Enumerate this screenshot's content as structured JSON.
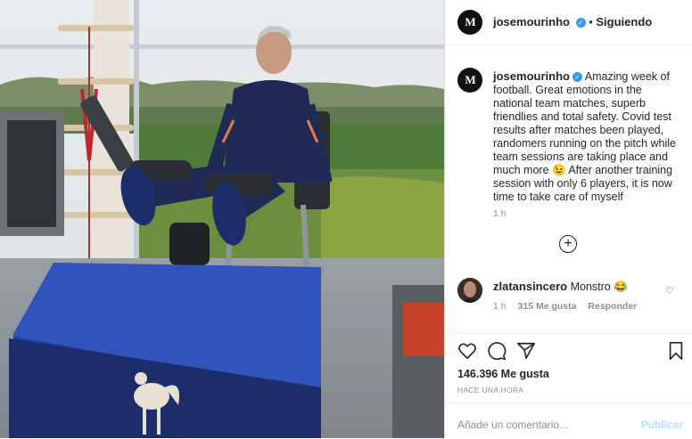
{
  "post": {
    "username": "josemourinho",
    "avatar_text": "M",
    "follow_state": "Siguiendo",
    "separator": "•",
    "caption": "Amazing week of football. Great emotions in the national team matches, superb friendlies and total safety. Covid test results after matches been played, randomers running on the pitch while team sessions are taking place and much more 😉 After another training session with only 6 players, it is now time to take care of myself",
    "caption_time": "1 h",
    "load_more_icon": "plus-circle-icon",
    "comments": [
      {
        "username": "zlatansincero",
        "text": "Monstro 😂",
        "time": "1 h",
        "likes": "315 Me gusta",
        "reply": "Responder"
      }
    ],
    "likes_text": "146.396 Me gusta",
    "time_ago": "HACE UNA HORA",
    "comment_placeholder": "Añade un comentario...",
    "publish_label": "Publicar"
  },
  "icons": {
    "like": "heart-icon",
    "comment": "comment-icon",
    "share": "send-icon",
    "save": "bookmark-icon",
    "verified": "verified-badge-icon"
  },
  "colors": {
    "verified": "#3897f0",
    "text": "#262626",
    "muted": "#8e8e8e",
    "publish_disabled": "#b2dffc",
    "box_blue": "#243f9e"
  }
}
